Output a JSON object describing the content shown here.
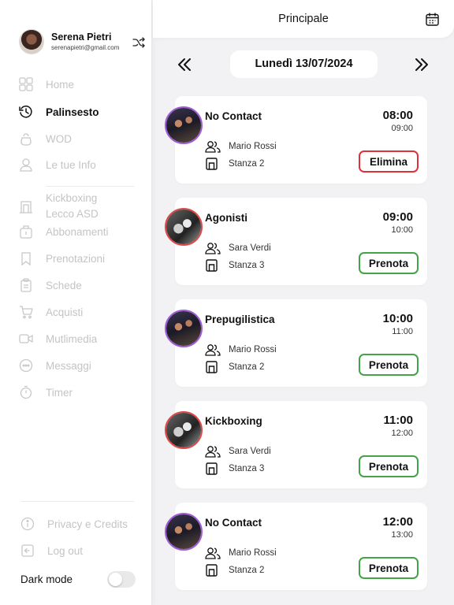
{
  "profile": {
    "name": "Serena Pietri",
    "email": "serenapietri@gmail.com"
  },
  "nav": {
    "home": "Home",
    "palinsesto": "Palinsesto",
    "wod": "WOD",
    "info": "Le tue Info",
    "gym_line1": "Kickboxing",
    "gym_line2": "Lecco ASD",
    "abbonamenti": "Abbonamenti",
    "prenotazioni": "Prenotazioni",
    "schede": "Schede",
    "acquisti": "Acquisti",
    "multimedia": "Mutlimedia",
    "messaggi": "Messaggi",
    "timer": "Timer",
    "privacy": "Privacy e Credits",
    "logout": "Log out"
  },
  "dark_mode": {
    "label": "Dark mode",
    "enabled": false
  },
  "header": {
    "title": "Principale"
  },
  "date": {
    "label": "Lunedì 13/07/2024"
  },
  "classes": [
    {
      "title": "No Contact",
      "start": "08:00",
      "end": "09:00",
      "coach": "Mario Rossi",
      "room": "Stanza 2",
      "action": "Elimina"
    },
    {
      "title": "Agonisti",
      "start": "09:00",
      "end": "10:00",
      "coach": "Sara Verdi",
      "room": "Stanza 3",
      "action": "Prenota"
    },
    {
      "title": "Prepugilistica",
      "start": "10:00",
      "end": "11:00",
      "coach": "Mario Rossi",
      "room": "Stanza 2",
      "action": "Prenota"
    },
    {
      "title": "Kickboxing",
      "start": "11:00",
      "end": "12:00",
      "coach": "Sara Verdi",
      "room": "Stanza 3",
      "action": "Prenota"
    },
    {
      "title": "No Contact",
      "start": "12:00",
      "end": "13:00",
      "coach": "Mario Rossi",
      "room": "Stanza 2",
      "action": "Prenota"
    }
  ],
  "colors": {
    "accent_book": "#43a447",
    "accent_delete": "#e0303a",
    "muted_nav": "#c4c4c4"
  }
}
